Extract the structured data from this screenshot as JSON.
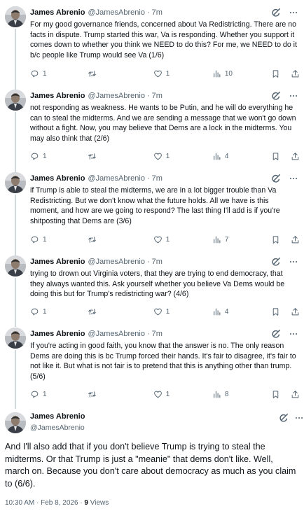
{
  "author": {
    "name": "James Abrenio",
    "handle": "@JamesAbrenio",
    "dot": "·"
  },
  "tweets": [
    {
      "time": "7m",
      "text": "For my good governance friends, concerned about Va Redistricting. There are no facts in dispute. Trump started this war, Va is responding. Whether you support it comes down to whether you think we NEED to do this? For me, we NEED to do it b/c people like Trump would see Va (1/6)",
      "replies": "1",
      "reposts": "",
      "likes": "1",
      "views": "10"
    },
    {
      "time": "7m",
      "text": "not responding as weakness. He wants to be Putin, and he will do everything he can to steal the midterms. And we are sending a message that we won't go down without a fight. Now, you may believe that Dems are a lock in the midterms. You may also think that (2/6)",
      "replies": "1",
      "reposts": "",
      "likes": "1",
      "views": "4"
    },
    {
      "time": "7m",
      "text": "if Trump is able to steal the midterms, we are in a lot bigger trouble than Va Redistricting. But we don't know what the future holds. All we have is this moment, and how are we going to respond? The last thing I'll add is if you're shitposting that Dems are (3/6)",
      "replies": "1",
      "reposts": "",
      "likes": "1",
      "views": "7"
    },
    {
      "time": "7m",
      "text": "trying to drown out Virginia voters, that they are trying to end democracy, that they always wanted this. Ask yourself whether you believe Va Dems would be doing this but for Trump's redistricting war? (4/6)",
      "replies": "1",
      "reposts": "",
      "likes": "1",
      "views": "4"
    },
    {
      "time": "7m",
      "text": "If you're acting in good faith, you know that the answer is no. The only reason Dems are doing this is bc Trump forced their hands. It's fair to disagree, it's fair to not like it. But what is not fair is to pretend that this is anything other than trump. (5/6)",
      "replies": "1",
      "reposts": "",
      "likes": "1",
      "views": "8"
    }
  ],
  "focal": {
    "text": "And I'll also add that if you don't believe Trump is trying to steal the midterms. Or that Trump is just a \"meanie\" that dems don't like. Well, march on. Because you don't care about democracy as much as you claim to (6/6).",
    "timestamp": "10:30 AM · Feb 8, 2026 · ",
    "views_count": "9",
    "views_label": " Views"
  },
  "icons": {
    "reply": "reply-icon",
    "repost": "repost-icon",
    "like": "like-icon",
    "views": "views-icon",
    "bookmark": "bookmark-icon",
    "share": "share-icon",
    "grok": "grok-icon",
    "more": "more-icon"
  },
  "colors": {
    "text": "#0f1419",
    "secondary": "#536471",
    "thread_line": "#cfd9de"
  }
}
